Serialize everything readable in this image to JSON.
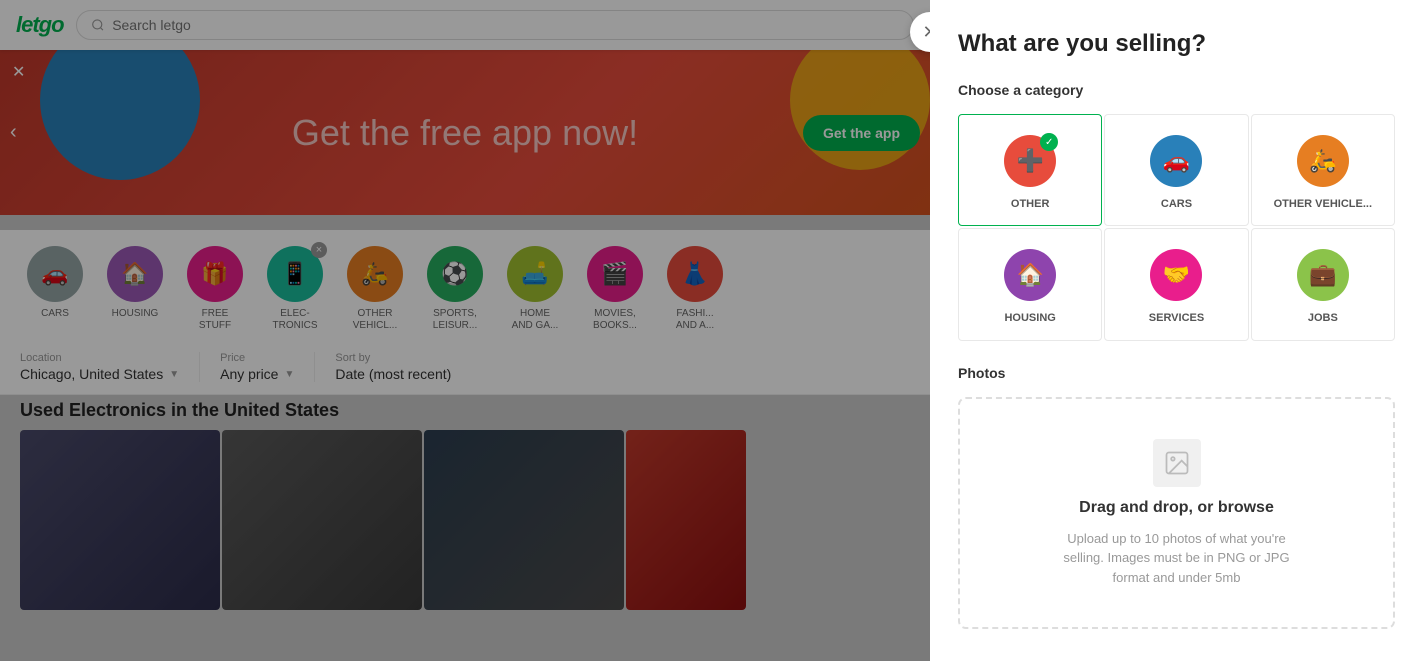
{
  "header": {
    "logo": "letgo",
    "search_placeholder": "Search letgo"
  },
  "banner": {
    "text": "Get the free app now!",
    "button_label": "Get the app"
  },
  "categories_bar": [
    {
      "id": "cars",
      "label": "CARS",
      "color": "bg-gray",
      "icon": "🚗",
      "has_x": false
    },
    {
      "id": "housing",
      "label": "HOUSING",
      "color": "bg-light-purple",
      "icon": "🏠",
      "has_x": false
    },
    {
      "id": "free-stuff",
      "label": "FREE\nSTUFF",
      "color": "bg-pink",
      "icon": "🎁",
      "has_x": false
    },
    {
      "id": "electronics",
      "label": "ELEC-\nTRONICS",
      "color": "bg-teal",
      "icon": "📱",
      "has_x": true
    },
    {
      "id": "other-vehicles",
      "label": "OTHER\nVEHICL...",
      "color": "bg-orange",
      "icon": "🛵",
      "has_x": false
    },
    {
      "id": "sports",
      "label": "SPORTS,\nLEISUR...",
      "color": "bg-dark-green",
      "icon": "⚽",
      "has_x": false
    },
    {
      "id": "home-garden",
      "label": "HOME\nAND GA...",
      "color": "bg-yellow-green",
      "icon": "🛋️",
      "has_x": false
    },
    {
      "id": "movies-books",
      "label": "MOVIES,\nBOOKS...",
      "color": "bg-pink",
      "icon": "🎬",
      "has_x": false
    },
    {
      "id": "fashion",
      "label": "FASHI...\nAND A...",
      "color": "bg-red",
      "icon": "👗",
      "has_x": false
    }
  ],
  "filters": {
    "location_label": "Location",
    "location_value": "Chicago, United States",
    "price_label": "Price",
    "price_value": "Any price",
    "sort_label": "Sort by",
    "sort_value": "Date (most recent)"
  },
  "page_heading": "Used Electronics in the United States",
  "modal": {
    "title": "What are you selling?",
    "choose_category_label": "Choose a category",
    "photos_label": "Photos",
    "upload_title": "Drag and drop, or browse",
    "upload_desc": "Upload up to 10 photos of what you're selling. Images must be in PNG or JPG format and under 5mb",
    "categories": [
      {
        "id": "other",
        "label": "OTHER",
        "color": "#e74c3c",
        "icon": "➕",
        "selected": true
      },
      {
        "id": "cars",
        "label": "CARS",
        "color": "#2980b9",
        "icon": "🚗",
        "selected": false
      },
      {
        "id": "other-vehicles",
        "label": "OTHER\nVEHICLE...",
        "color": "#e67e22",
        "icon": "🛵",
        "selected": false
      },
      {
        "id": "housing",
        "label": "HOUSING",
        "color": "#8e44ad",
        "icon": "🏠",
        "selected": false
      },
      {
        "id": "services",
        "label": "SERVICES",
        "color": "#e91e8c",
        "icon": "🤝",
        "selected": false
      },
      {
        "id": "jobs",
        "label": "JOBS",
        "color": "#8bc34a",
        "icon": "💼",
        "selected": false
      }
    ]
  }
}
